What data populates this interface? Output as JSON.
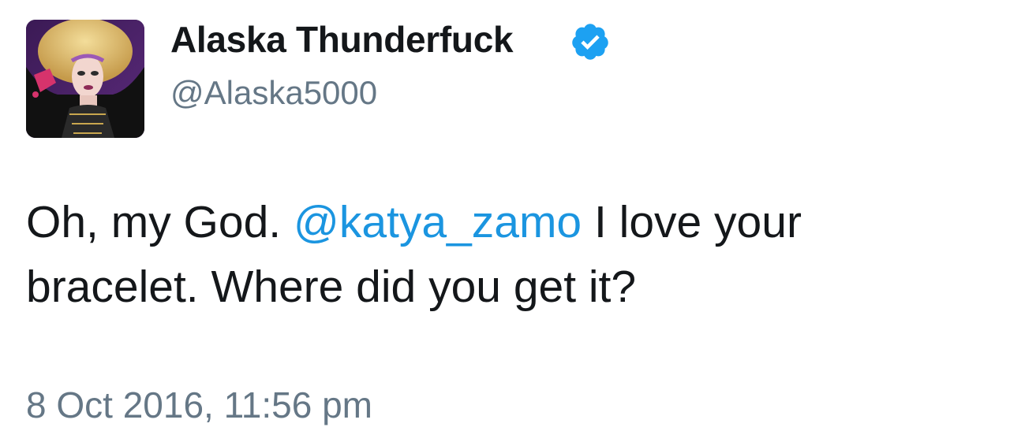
{
  "author": {
    "display_name": "Alaska Thunderfuck",
    "handle": "@Alaska5000",
    "verified": true,
    "avatar_icon": "profile-photo-drag-queen"
  },
  "tweet": {
    "text_before": "Oh, my God. ",
    "mention": "@katya_zamo",
    "text_line1_after": " I love your",
    "text_line2": "bracelet. Where did you get it?"
  },
  "timestamp": "8 Oct 2016, 11:56 pm",
  "colors": {
    "mention": "#1b95e0",
    "muted": "#657786",
    "verified_badge": "#1da1f2",
    "text": "#14171a"
  }
}
